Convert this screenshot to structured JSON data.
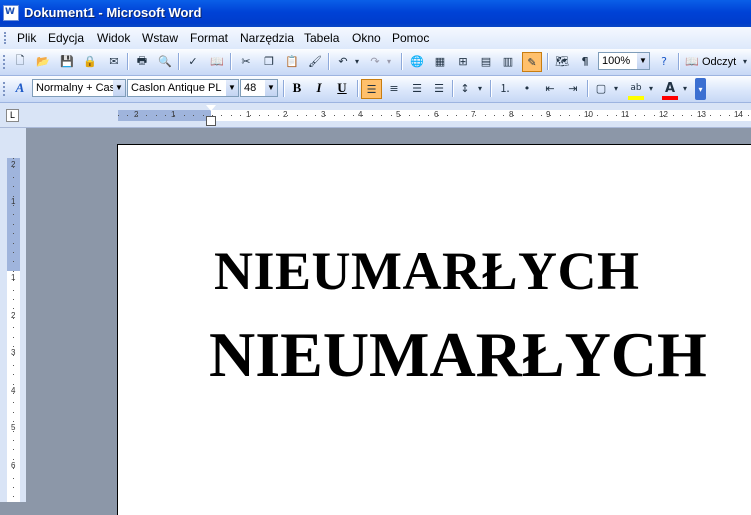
{
  "window": {
    "title": "Dokument1 - Microsoft Word"
  },
  "menu": {
    "items": [
      "Plik",
      "Edycja",
      "Widok",
      "Wstaw",
      "Format",
      "Narzędzia",
      "Tabela",
      "Okno",
      "Pomoc"
    ]
  },
  "toolbar": {
    "zoom": "100%",
    "reading_label": "Odczyt"
  },
  "formatting": {
    "style": "Normalny + Cas",
    "font": "Caslon Antique PL",
    "size": "48",
    "bold": "B",
    "italic": "I",
    "underline": "U"
  },
  "document": {
    "lines": [
      "NIEUMARŁYCH",
      "NIEUMARŁYCH"
    ]
  },
  "ruler": {
    "h_numbers": [
      "2",
      "1",
      "1",
      "2",
      "3",
      "4",
      "5",
      "6",
      "7",
      "8",
      "9",
      "10",
      "11",
      "12",
      "13",
      "14"
    ],
    "v_numbers": [
      "2",
      "1",
      "1",
      "2",
      "3",
      "4",
      "5",
      "6"
    ]
  },
  "colors": {
    "highlight": "#ffff00",
    "font_color": "#ff0000",
    "titlebar": "#0042d6"
  }
}
